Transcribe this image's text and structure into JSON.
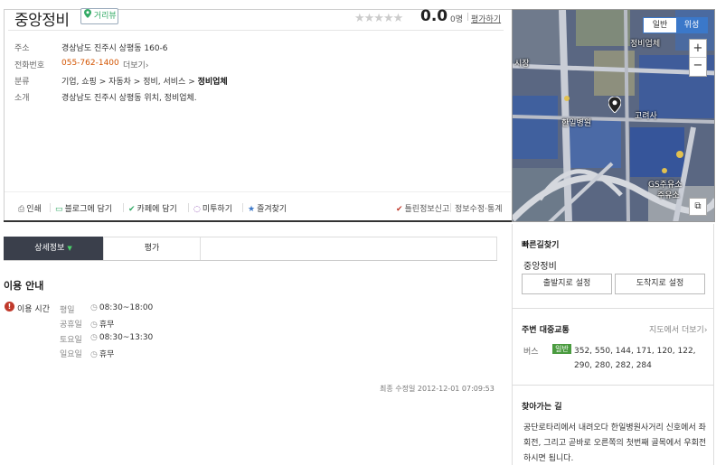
{
  "place": {
    "title": "중앙정비",
    "roadview_label": "거리뷰",
    "stars": "★★★★★",
    "score": "0.0",
    "score_count": "0명",
    "score_sep": "|",
    "rate_link": "평가하기"
  },
  "info": {
    "address_label": "주소",
    "address": "경상남도 진주시 상평동 160-6",
    "phone_label": "전화번호",
    "phone": "055-762-1400",
    "phone_more": "더보기›",
    "category_label": "분류",
    "category_path": "기업, 쇼핑 > 자동차 > 정비, 서비스 > ",
    "category_leaf": "정비업체",
    "intro_label": "소개",
    "intro": "경상남도 진주시 상평동 위치, 정비업체."
  },
  "toolbar": {
    "print": "인쇄",
    "blog": "블로그에 담기",
    "cafe": "카페에 담기",
    "me2day": "미투하기",
    "favorite": "즐겨찾기",
    "report": "틀린정보신고",
    "edit": "정보수정·통계"
  },
  "map": {
    "toggle_normal": "일반",
    "toggle_satellite": "위성",
    "zoom_in": "+",
    "zoom_out": "−",
    "labels": [
      "정비업체",
      "시장",
      "한일병원",
      "고려사",
      "GS주유소",
      "주유소"
    ],
    "colors": {
      "accent": "#3b78c9",
      "road": "#c9cdd6"
    }
  },
  "tabs": {
    "detail": "상세정보",
    "review": "평가"
  },
  "usage": {
    "title": "이용 안내",
    "label": "이용 시간",
    "hours": [
      {
        "day": "평일",
        "time": "08:30~18:00"
      },
      {
        "day": "공휴일",
        "time": "휴무"
      },
      {
        "day": "토요일",
        "time": "08:30~13:30"
      },
      {
        "day": "일요일",
        "time": "휴무"
      }
    ],
    "updated": "최종 수정일 2012-12-01 07:09:53"
  },
  "side": {
    "quick_title": "빠른길찾기",
    "place_name": "중앙정비",
    "start_btn": "출발지로 설정",
    "end_btn": "도착지로 설정",
    "transit_title": "주변 대중교통",
    "map_more": "지도에서 더보기›",
    "bus_label": "버스",
    "bus_badge": "일반",
    "bus_routes": "352, 550, 144, 171, 120, 122, 290, 280, 282, 284",
    "directions_title": "찾아가는 길",
    "directions": "공단로타리에서 내려오다 한일병원사거리 신호에서 좌회전, 그리고 곧바로 오른쪽의 첫번째 골목에서 우회전하시면 됩니다."
  }
}
